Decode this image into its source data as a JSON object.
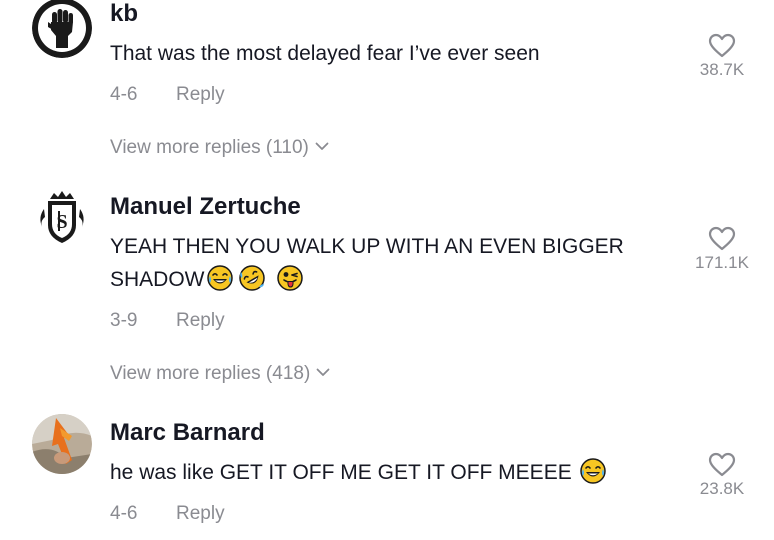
{
  "comments": [
    {
      "username": "kb",
      "text": "That was the most delayed fear I’ve ever seen",
      "emojis": [],
      "date": "4-6",
      "reply_label": "Reply",
      "likes": "38.7K",
      "view_more": "View more replies (110)",
      "avatar_icon": "raised-fist"
    },
    {
      "username": "Manuel Zertuche",
      "text": "YEAH THEN YOU WALK UP WITH AN EVEN BIGGER SHADOW",
      "emojis": [
        "tears-of-joy",
        "rolling-laughing",
        "winking-tongue"
      ],
      "date": "3-9",
      "reply_label": "Reply",
      "likes": "171.1K",
      "view_more": "View more replies (418)",
      "avatar_icon": "crest"
    },
    {
      "username": "Marc Barnard",
      "text": "he was like GET IT OFF ME GET IT OFF MEEEE",
      "emojis": [
        "tears-of-joy"
      ],
      "date": "4-6",
      "reply_label": "Reply",
      "likes": "23.8K",
      "avatar_icon": "photo"
    }
  ],
  "colors": {
    "primary_text": "#161823",
    "secondary_text": "#8a8b91"
  }
}
